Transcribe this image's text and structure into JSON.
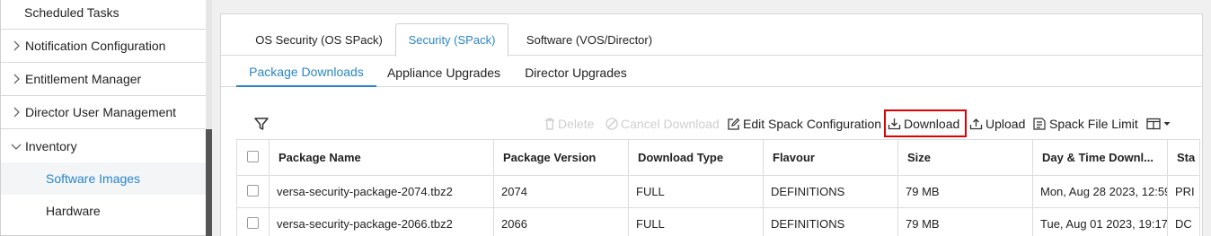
{
  "sidebar": {
    "items": [
      {
        "label": "Scheduled Tasks"
      },
      {
        "label": "Notification Configuration"
      },
      {
        "label": "Entitlement Manager"
      },
      {
        "label": "Director User Management"
      },
      {
        "label": "Inventory"
      }
    ],
    "sub_items": [
      {
        "label": "Software Images"
      },
      {
        "label": "Hardware"
      }
    ]
  },
  "tabs_primary": [
    {
      "label": "OS Security (OS SPack)"
    },
    {
      "label": "Security (SPack)"
    },
    {
      "label": "Software (VOS/Director)"
    }
  ],
  "tabs_secondary": [
    {
      "label": "Package Downloads"
    },
    {
      "label": "Appliance Upgrades"
    },
    {
      "label": "Director Upgrades"
    }
  ],
  "toolbar": {
    "delete": "Delete",
    "cancel_download": "Cancel Download",
    "edit_spack": "Edit Spack Configuration",
    "download": "Download",
    "upload": "Upload",
    "spack_limit": "Spack File Limit"
  },
  "table": {
    "headers": [
      "Package Name",
      "Package Version",
      "Download Type",
      "Flavour",
      "Size",
      "Day & Time Downl...",
      "Sta"
    ],
    "rows": [
      [
        "versa-security-package-2074.tbz2",
        "2074",
        "FULL",
        "DEFINITIONS",
        "79 MB",
        "Mon, Aug 28 2023, 12:59",
        "PRI"
      ],
      [
        "versa-security-package-2066.tbz2",
        "2066",
        "FULL",
        "DEFINITIONS",
        "79 MB",
        "Tue, Aug 01 2023, 19:17",
        "DC"
      ]
    ]
  },
  "colors": {
    "accent": "#2a86c8",
    "highlight_box": "#e00000"
  }
}
